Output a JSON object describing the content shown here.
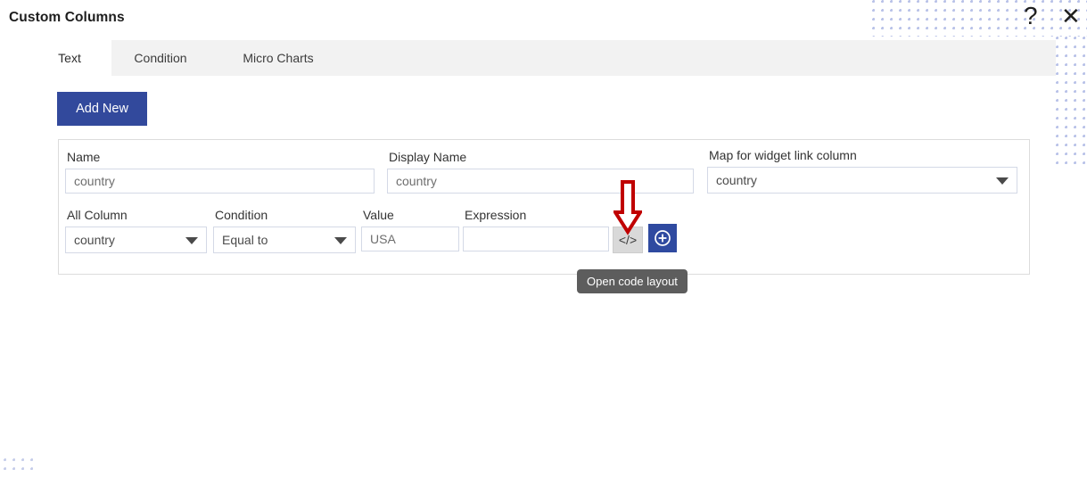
{
  "window": {
    "title": "Custom Columns",
    "help_icon": "question-mark-icon",
    "close_icon": "close-icon",
    "help_glyph": "?",
    "close_glyph": "✕"
  },
  "tabs": [
    {
      "label": "Text",
      "active": true
    },
    {
      "label": "Condition",
      "active": false
    },
    {
      "label": "Micro Charts",
      "active": false
    }
  ],
  "toolbar": {
    "add_new_label": "Add New"
  },
  "form": {
    "row1": {
      "name": {
        "label": "Name",
        "value": "country",
        "placeholder": "country"
      },
      "display_name": {
        "label": "Display Name",
        "value": "country",
        "placeholder": "country"
      },
      "map_widget_link": {
        "label": "Map for widget link column",
        "value": "country"
      }
    },
    "row2": {
      "all_column": {
        "label": "All Column",
        "value": "country"
      },
      "condition": {
        "label": "Condition",
        "value": "Equal to"
      },
      "value": {
        "label": "Value",
        "value": "USA",
        "placeholder": "USA"
      },
      "expression": {
        "label": "Expression",
        "value": "",
        "placeholder": ""
      }
    },
    "code_button": {
      "label": "</>",
      "icon": "code-brackets-icon"
    },
    "add_row_button": {
      "icon": "plus-circle-icon",
      "label": ""
    }
  },
  "tooltip": {
    "text": "Open code layout"
  },
  "annotation": {
    "arrow": "down-arrow-annotation",
    "color": "#c00000"
  },
  "colors": {
    "primary_blue": "#32499c",
    "tab_strip_gray": "#f2f2f2",
    "tooltip_gray": "#5d5d5d",
    "code_btn_gray": "#d9d9d9",
    "dot_pattern": "#b9c2e8",
    "annotation_red": "#c00000"
  }
}
